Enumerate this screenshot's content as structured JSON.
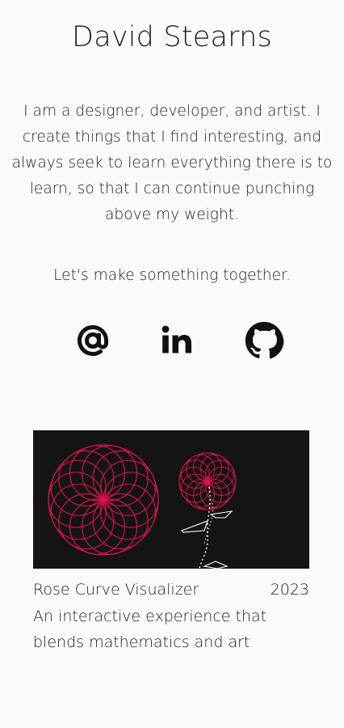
{
  "header": {
    "name": "David Stearns"
  },
  "intro": {
    "bio": "I am a designer, developer, and artist. I create things that I find interesting, and always seek to learn everything there is to learn, so that I can continue punching above my weight.",
    "cta": "Let's make something together."
  },
  "social": [
    {
      "icon": "at-sign-icon",
      "label": "Email"
    },
    {
      "icon": "linkedin-icon",
      "label": "LinkedIn"
    },
    {
      "icon": "github-icon",
      "label": "GitHub"
    }
  ],
  "projects": [
    {
      "title": "Rose Curve Visualizer",
      "year": "2023",
      "description": "An interactive experience that blends mathematics and art",
      "thumbnail_icon": "rose-curve-illustration",
      "colors": {
        "background": "#141414",
        "accent": "#e0124f",
        "line": "#ffffff"
      }
    }
  ]
}
